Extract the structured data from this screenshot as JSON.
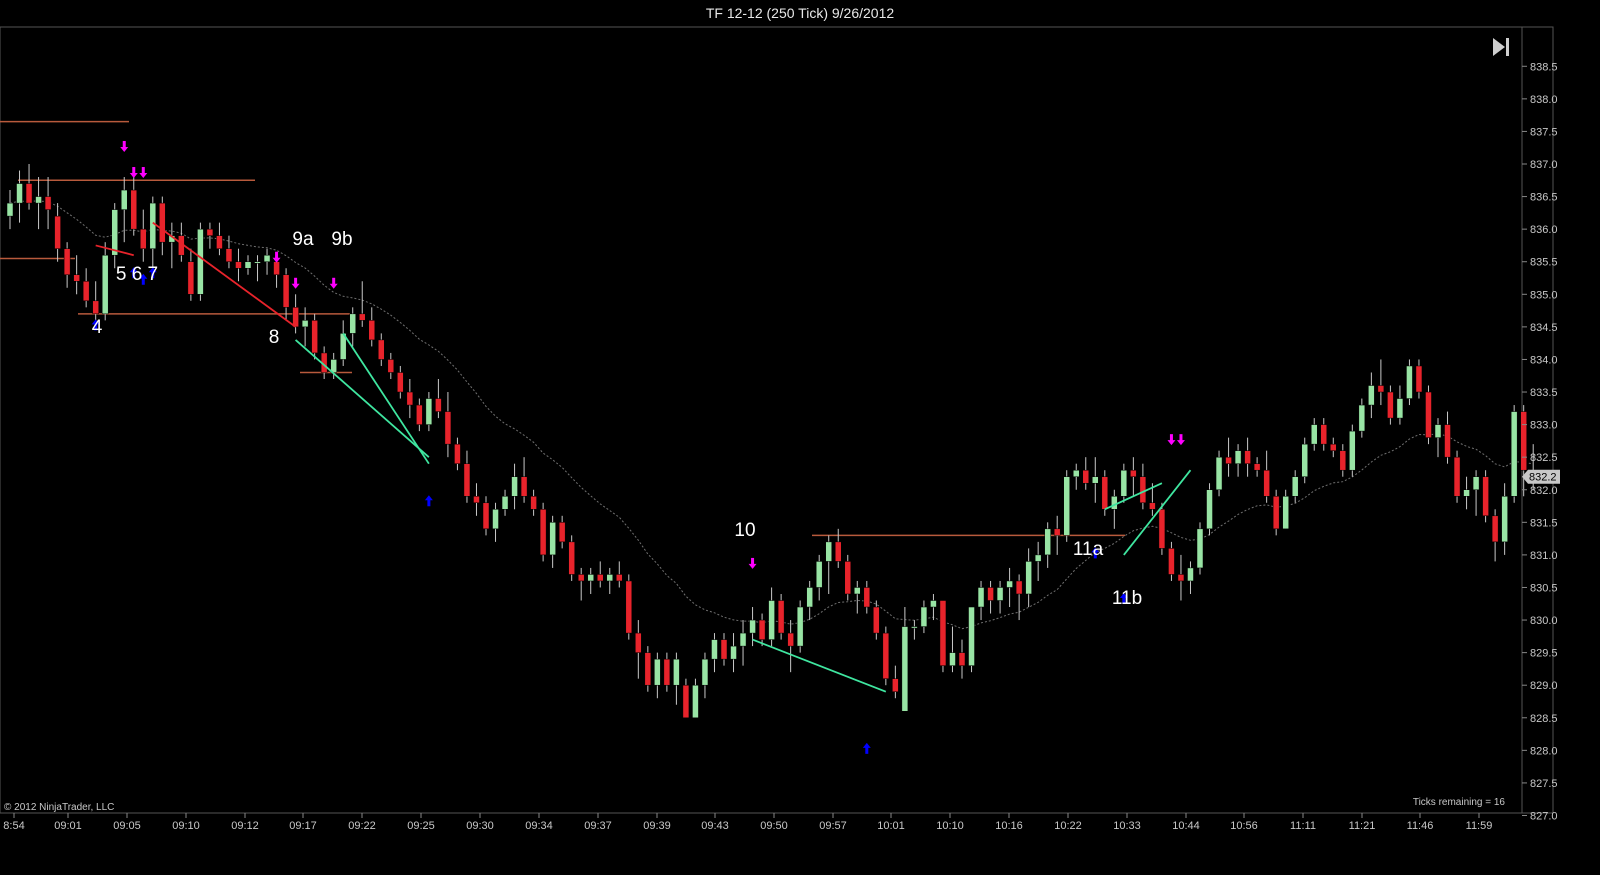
{
  "window": {
    "title": "TF 12-12 (250 Tick)  9/26/2012"
  },
  "footer": {
    "copyright": "© 2012 NinjaTrader, LLC",
    "ticks_remaining": "Ticks remaining = 16"
  },
  "controls": {
    "goto_end_icon": "skip-to-end-icon"
  },
  "colors": {
    "up_candle": "#98e4a4",
    "down_candle": "#e8232b",
    "level_line": "#b85a3c",
    "green_trend": "#3fe6a0",
    "red_trend": "#e8232b",
    "sell_arrow": "#ff00ff",
    "buy_arrow": "#0000ff",
    "ema": "#707070"
  },
  "chart_data": {
    "type": "candlestick",
    "title": "TF 12-12 (250 Tick)  9/26/2012",
    "ylim": [
      826.5,
      838.6
    ],
    "y_ticks": [
      "838.5",
      "838.0",
      "837.5",
      "837.0",
      "836.5",
      "836.0",
      "835.5",
      "835.0",
      "834.5",
      "834.0",
      "833.5",
      "833.0",
      "832.5",
      "832.0",
      "831.5",
      "831.0",
      "830.5",
      "830.0",
      "829.5",
      "829.0",
      "828.5",
      "828.0",
      "827.5",
      "827.0"
    ],
    "x_ticks": [
      "8:54",
      "09:01",
      "09:05",
      "09:10",
      "09:12",
      "09:17",
      "09:22",
      "09:25",
      "09:30",
      "09:34",
      "09:37",
      "09:39",
      "09:43",
      "09:50",
      "09:57",
      "10:01",
      "10:10",
      "10:16",
      "10:22",
      "10:33",
      "10:44",
      "10:56",
      "11:11",
      "11:21",
      "11:46",
      "11:59"
    ],
    "last_price": "832.2",
    "ohlc": [
      [
        836.2,
        836.6,
        836.0,
        836.4
      ],
      [
        836.4,
        836.9,
        836.1,
        836.7
      ],
      [
        836.7,
        837.0,
        836.3,
        836.4
      ],
      [
        836.4,
        836.8,
        836.0,
        836.5
      ],
      [
        836.5,
        836.8,
        836.0,
        836.3
      ],
      [
        836.2,
        836.4,
        835.5,
        835.7
      ],
      [
        835.7,
        835.8,
        835.1,
        835.3
      ],
      [
        835.3,
        835.6,
        835.0,
        835.2
      ],
      [
        835.2,
        835.4,
        834.8,
        834.9
      ],
      [
        834.9,
        835.2,
        834.6,
        834.7
      ],
      [
        834.7,
        835.8,
        834.6,
        835.6
      ],
      [
        835.6,
        836.4,
        835.4,
        836.3
      ],
      [
        836.3,
        836.8,
        835.8,
        836.6
      ],
      [
        836.6,
        836.9,
        835.9,
        836.0
      ],
      [
        836.0,
        836.3,
        835.5,
        835.7
      ],
      [
        835.7,
        836.5,
        835.4,
        836.4
      ],
      [
        836.4,
        836.5,
        835.6,
        835.8
      ],
      [
        835.8,
        836.1,
        835.4,
        835.9
      ],
      [
        835.9,
        836.1,
        835.5,
        835.6
      ],
      [
        835.5,
        835.7,
        834.9,
        835.0
      ],
      [
        835.0,
        836.1,
        834.9,
        836.0
      ],
      [
        836.0,
        836.1,
        835.7,
        835.9
      ],
      [
        835.9,
        836.1,
        835.6,
        835.7
      ],
      [
        835.7,
        835.9,
        835.4,
        835.5
      ],
      [
        835.5,
        835.7,
        835.2,
        835.4
      ],
      [
        835.4,
        835.6,
        835.3,
        835.5
      ],
      [
        835.5,
        835.6,
        835.2,
        835.5
      ],
      [
        835.5,
        835.7,
        835.3,
        835.6
      ],
      [
        835.5,
        835.6,
        835.1,
        835.3
      ],
      [
        835.3,
        835.4,
        834.6,
        834.8
      ],
      [
        834.8,
        835.0,
        834.4,
        834.5
      ],
      [
        834.5,
        834.8,
        834.2,
        834.6
      ],
      [
        834.6,
        834.7,
        834.0,
        834.1
      ],
      [
        834.1,
        834.2,
        833.7,
        833.8
      ],
      [
        833.8,
        834.1,
        833.7,
        834.0
      ],
      [
        834.0,
        834.6,
        833.9,
        834.4
      ],
      [
        834.4,
        834.8,
        834.2,
        834.7
      ],
      [
        834.7,
        835.2,
        834.5,
        834.6
      ],
      [
        834.6,
        834.8,
        834.2,
        834.3
      ],
      [
        834.3,
        834.4,
        833.9,
        834.0
      ],
      [
        834.0,
        834.1,
        833.7,
        833.8
      ],
      [
        833.8,
        833.9,
        833.4,
        833.5
      ],
      [
        833.5,
        833.7,
        833.1,
        833.3
      ],
      [
        833.3,
        833.4,
        832.9,
        833.0
      ],
      [
        833.0,
        833.5,
        832.9,
        833.4
      ],
      [
        833.4,
        833.7,
        833.1,
        833.2
      ],
      [
        833.2,
        833.5,
        832.5,
        832.7
      ],
      [
        832.7,
        832.8,
        832.3,
        832.4
      ],
      [
        832.4,
        832.6,
        831.8,
        831.9
      ],
      [
        831.9,
        832.1,
        831.6,
        831.8
      ],
      [
        831.8,
        831.9,
        831.3,
        831.4
      ],
      [
        831.4,
        831.8,
        831.2,
        831.7
      ],
      [
        831.7,
        832.0,
        831.6,
        831.9
      ],
      [
        831.9,
        832.4,
        831.7,
        832.2
      ],
      [
        832.2,
        832.5,
        831.8,
        831.9
      ],
      [
        831.9,
        832.0,
        831.6,
        831.7
      ],
      [
        831.7,
        831.8,
        830.9,
        831.0
      ],
      [
        831.0,
        831.6,
        830.8,
        831.5
      ],
      [
        831.5,
        831.6,
        831.1,
        831.2
      ],
      [
        831.2,
        831.3,
        830.6,
        830.7
      ],
      [
        830.7,
        830.8,
        830.3,
        830.6
      ],
      [
        830.6,
        830.8,
        830.4,
        830.7
      ],
      [
        830.7,
        830.9,
        830.5,
        830.6
      ],
      [
        830.6,
        830.8,
        830.4,
        830.7
      ],
      [
        830.7,
        830.9,
        830.5,
        830.6
      ],
      [
        830.6,
        830.7,
        829.7,
        829.8
      ],
      [
        829.8,
        830.0,
        829.1,
        829.5
      ],
      [
        829.5,
        829.6,
        828.9,
        829.0
      ],
      [
        829.0,
        829.5,
        828.8,
        829.4
      ],
      [
        829.4,
        829.5,
        828.9,
        829.0
      ],
      [
        829.0,
        829.5,
        828.7,
        829.4
      ],
      [
        829.0,
        829.1,
        828.5,
        828.5
      ],
      [
        828.5,
        829.1,
        828.5,
        829.0
      ],
      [
        829.0,
        829.5,
        828.8,
        829.4
      ],
      [
        829.4,
        829.8,
        829.2,
        829.7
      ],
      [
        829.7,
        829.8,
        829.3,
        829.4
      ],
      [
        829.4,
        829.8,
        829.2,
        829.6
      ],
      [
        829.6,
        830.0,
        829.3,
        829.8
      ],
      [
        829.8,
        830.2,
        829.6,
        830.0
      ],
      [
        830.0,
        830.1,
        829.6,
        829.7
      ],
      [
        829.7,
        830.5,
        829.6,
        830.3
      ],
      [
        830.3,
        830.4,
        829.7,
        829.8
      ],
      [
        829.8,
        830.0,
        829.2,
        829.6
      ],
      [
        829.6,
        830.3,
        829.5,
        830.2
      ],
      [
        830.2,
        830.6,
        830.0,
        830.5
      ],
      [
        830.5,
        831.0,
        830.3,
        830.9
      ],
      [
        830.9,
        831.3,
        830.4,
        831.2
      ],
      [
        831.2,
        831.4,
        830.8,
        830.9
      ],
      [
        830.9,
        831.0,
        830.3,
        830.4
      ],
      [
        830.4,
        830.6,
        830.1,
        830.5
      ],
      [
        830.5,
        830.6,
        830.1,
        830.2
      ],
      [
        830.2,
        830.3,
        829.7,
        829.8
      ],
      [
        829.8,
        829.9,
        829.0,
        829.1
      ],
      [
        829.1,
        829.3,
        828.8,
        828.9
      ],
      [
        828.6,
        830.2,
        828.6,
        829.9
      ],
      [
        829.9,
        830.0,
        829.7,
        829.9
      ],
      [
        829.9,
        830.3,
        829.8,
        830.2
      ],
      [
        830.2,
        830.4,
        830.0,
        830.3
      ],
      [
        830.3,
        830.3,
        829.2,
        829.3
      ],
      [
        829.3,
        829.9,
        829.2,
        829.5
      ],
      [
        829.5,
        829.7,
        829.1,
        829.3
      ],
      [
        829.3,
        830.2,
        829.2,
        830.2
      ],
      [
        830.2,
        830.6,
        830.0,
        830.5
      ],
      [
        830.5,
        830.6,
        830.1,
        830.3
      ],
      [
        830.3,
        830.6,
        830.1,
        830.5
      ],
      [
        830.5,
        830.8,
        830.2,
        830.6
      ],
      [
        830.6,
        830.7,
        830.0,
        830.4
      ],
      [
        830.4,
        831.1,
        830.2,
        830.9
      ],
      [
        830.9,
        831.2,
        830.6,
        831.0
      ],
      [
        831.0,
        831.5,
        830.8,
        831.4
      ],
      [
        831.4,
        831.6,
        831.0,
        831.3
      ],
      [
        831.3,
        832.3,
        831.2,
        832.2
      ],
      [
        832.2,
        832.4,
        832.0,
        832.3
      ],
      [
        832.3,
        832.5,
        832.0,
        832.1
      ],
      [
        832.1,
        832.5,
        831.8,
        832.2
      ],
      [
        832.2,
        832.3,
        831.6,
        831.7
      ],
      [
        831.7,
        832.0,
        831.4,
        831.9
      ],
      [
        831.9,
        832.4,
        831.8,
        832.3
      ],
      [
        832.3,
        832.5,
        831.9,
        832.2
      ],
      [
        832.2,
        832.4,
        831.7,
        831.8
      ],
      [
        831.8,
        832.1,
        831.6,
        831.7
      ],
      [
        831.7,
        831.8,
        831.0,
        831.1
      ],
      [
        831.1,
        831.2,
        830.6,
        830.7
      ],
      [
        830.7,
        831.0,
        830.3,
        830.6
      ],
      [
        830.6,
        830.9,
        830.4,
        830.8
      ],
      [
        830.8,
        831.5,
        830.7,
        831.4
      ],
      [
        831.4,
        832.1,
        831.3,
        832.0
      ],
      [
        832.0,
        832.6,
        831.9,
        832.5
      ],
      [
        832.5,
        832.8,
        832.2,
        832.4
      ],
      [
        832.4,
        832.7,
        832.2,
        832.6
      ],
      [
        832.6,
        832.8,
        832.2,
        832.4
      ],
      [
        832.4,
        832.5,
        832.2,
        832.3
      ],
      [
        832.3,
        832.6,
        831.8,
        831.9
      ],
      [
        831.9,
        832.0,
        831.3,
        831.4
      ],
      [
        831.4,
        832.0,
        831.4,
        831.9
      ],
      [
        831.9,
        832.3,
        831.8,
        832.2
      ],
      [
        832.2,
        832.8,
        832.1,
        832.7
      ],
      [
        832.7,
        833.1,
        832.6,
        833.0
      ],
      [
        833.0,
        833.1,
        832.6,
        832.7
      ],
      [
        832.7,
        832.8,
        832.5,
        832.6
      ],
      [
        832.6,
        832.7,
        832.2,
        832.3
      ],
      [
        832.3,
        833.0,
        832.2,
        832.9
      ],
      [
        832.9,
        833.4,
        832.8,
        833.3
      ],
      [
        833.3,
        833.8,
        833.1,
        833.6
      ],
      [
        833.6,
        834.0,
        833.3,
        833.5
      ],
      [
        833.5,
        833.6,
        833.0,
        833.1
      ],
      [
        833.1,
        833.6,
        833.0,
        833.4
      ],
      [
        833.4,
        834.0,
        833.3,
        833.9
      ],
      [
        833.9,
        834.0,
        833.4,
        833.5
      ],
      [
        833.5,
        833.6,
        832.7,
        832.8
      ],
      [
        832.8,
        833.1,
        832.5,
        833.0
      ],
      [
        833.0,
        833.2,
        832.4,
        832.5
      ],
      [
        832.5,
        832.6,
        831.8,
        831.9
      ],
      [
        831.9,
        832.2,
        831.7,
        832.0
      ],
      [
        832.0,
        832.3,
        831.6,
        832.2
      ],
      [
        832.2,
        832.3,
        831.5,
        831.6
      ],
      [
        831.6,
        831.7,
        830.9,
        831.2
      ],
      [
        831.2,
        832.1,
        831.0,
        831.9
      ],
      [
        831.9,
        833.3,
        831.8,
        833.2
      ],
      [
        833.2,
        833.3,
        831.9,
        832.3
      ],
      [
        832.3,
        832.7,
        832.0,
        832.2
      ]
    ],
    "annotations": [
      "4",
      "5 6 7",
      "8",
      "9a",
      "9b",
      "10",
      "11a",
      "11b"
    ]
  }
}
